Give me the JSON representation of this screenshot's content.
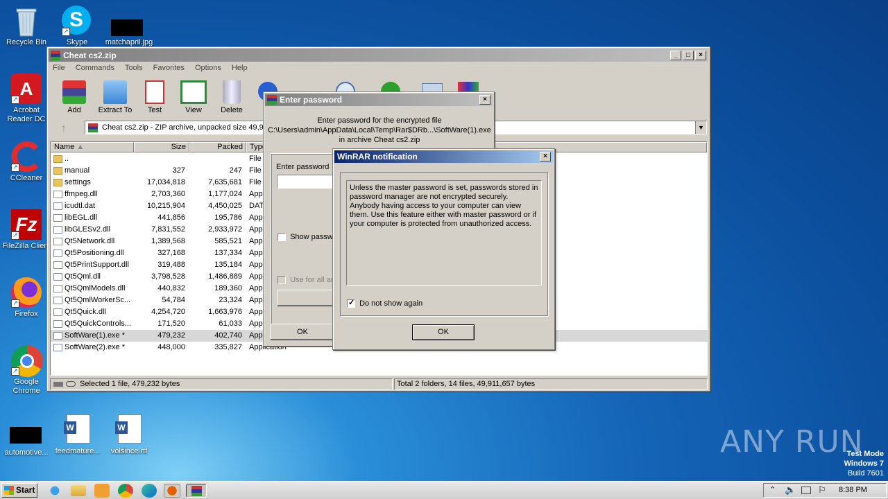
{
  "desktop": {
    "icons": [
      {
        "label": "Recycle Bin"
      },
      {
        "label": "Skype"
      },
      {
        "label": "matchapril.jpg"
      },
      {
        "label": "Acrobat Reader DC"
      },
      {
        "label": "CCleaner"
      },
      {
        "label": "FileZilla Client"
      },
      {
        "label": "Firefox"
      },
      {
        "label": "Google Chrome"
      },
      {
        "label": "automotive..."
      },
      {
        "label": "feedmature..."
      },
      {
        "label": "volsince.rtf"
      }
    ],
    "watermark": "ANY RUN",
    "os_info": {
      "line1": "Test Mode",
      "line2": "Windows 7",
      "line3": "Build 7601"
    }
  },
  "winrar": {
    "title": "Cheat cs2.zip",
    "menu": [
      "File",
      "Commands",
      "Tools",
      "Favorites",
      "Options",
      "Help"
    ],
    "toolbar": [
      "Add",
      "Extract To",
      "Test",
      "View",
      "Delete"
    ],
    "path": "Cheat cs2.zip - ZIP archive, unpacked size 49,91",
    "columns": {
      "name": "Name",
      "size": "Size",
      "packed": "Packed",
      "type": "Type"
    },
    "files": [
      {
        "name": "..",
        "size": "",
        "packed": "",
        "type": "File f"
      },
      {
        "name": "manual",
        "size": "327",
        "packed": "247",
        "type": "File f"
      },
      {
        "name": "settings",
        "size": "17,034,818",
        "packed": "7,635,681",
        "type": "File f"
      },
      {
        "name": "ffmpeg.dll",
        "size": "2,703,360",
        "packed": "1,177,024",
        "type": "Appl"
      },
      {
        "name": "icudtl.dat",
        "size": "10,215,904",
        "packed": "4,450,025",
        "type": "DAT"
      },
      {
        "name": "libEGL.dll",
        "size": "441,856",
        "packed": "195,786",
        "type": "Appl"
      },
      {
        "name": "libGLESv2.dll",
        "size": "7,831,552",
        "packed": "2,933,972",
        "type": "Appl"
      },
      {
        "name": "Qt5Network.dll",
        "size": "1,389,568",
        "packed": "585,521",
        "type": "Appl"
      },
      {
        "name": "Qt5Positioning.dll",
        "size": "327,168",
        "packed": "137,334",
        "type": "Appl"
      },
      {
        "name": "Qt5PrintSupport.dll",
        "size": "319,488",
        "packed": "135,184",
        "type": "Appl"
      },
      {
        "name": "Qt5Qml.dll",
        "size": "3,798,528",
        "packed": "1,486,889",
        "type": "Appl"
      },
      {
        "name": "Qt5QmlModels.dll",
        "size": "440,832",
        "packed": "189,360",
        "type": "Appl"
      },
      {
        "name": "Qt5QmlWorkerSc...",
        "size": "54,784",
        "packed": "23,324",
        "type": "Appl"
      },
      {
        "name": "Qt5Quick.dll",
        "size": "4,254,720",
        "packed": "1,663,976",
        "type": "Appl"
      },
      {
        "name": "Qt5QuickControls...",
        "size": "171,520",
        "packed": "61,033",
        "type": "Appl"
      },
      {
        "name": "SoftWare(1).exe *",
        "size": "479,232",
        "packed": "402,740",
        "type": "Appl"
      },
      {
        "name": "SoftWare(2).exe *",
        "size": "448,000",
        "packed": "335,827",
        "type": "Application"
      }
    ],
    "status_left": "Selected 1 file, 479,232 bytes",
    "status_right": "Total 2 folders, 14 files, 49,911,657 bytes"
  },
  "password_dialog": {
    "title": "Enter password",
    "line1": "Enter password for the encrypted file",
    "line2": "C:\\Users\\admin\\AppData\\Local\\Temp\\Rar$DRb...\\SoftWare(1).exe",
    "line3": "in archive Cheat cs2.zip",
    "field_label": "Enter password",
    "show_password": "Show passwo",
    "use_for_all": "Use for all ar",
    "ok": "OK"
  },
  "notification": {
    "title": "WinRAR notification",
    "message": "Unless the master password is set, passwords stored in password manager are not encrypted securely. Anybody having access to your computer can view them. Use this feature either with master password or if your computer is protected from unauthorized access.",
    "checkbox": "Do not show again",
    "ok": "OK"
  },
  "taskbar": {
    "start": "Start",
    "time": "8:38 PM"
  }
}
